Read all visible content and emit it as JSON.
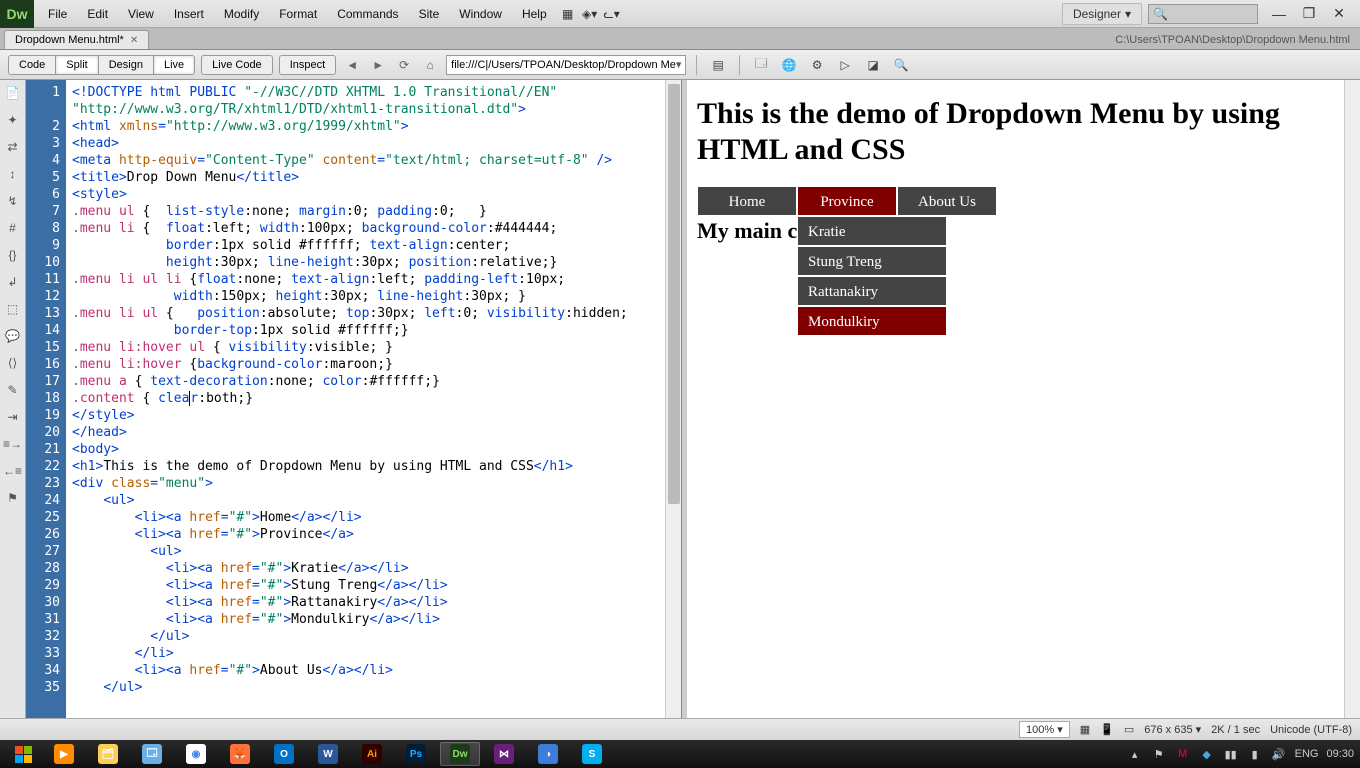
{
  "app": {
    "logo": "Dw"
  },
  "menu": {
    "items": [
      "File",
      "Edit",
      "View",
      "Insert",
      "Modify",
      "Format",
      "Commands",
      "Site",
      "Window",
      "Help"
    ]
  },
  "workspace": {
    "label": "Designer"
  },
  "search": {
    "placeholder": ""
  },
  "doc_tab": {
    "name": "Dropdown Menu.html*",
    "path": "C:\\Users\\TPOAN\\Desktop\\Dropdown Menu.html"
  },
  "view_modes": {
    "code": "Code",
    "split": "Split",
    "design": "Design",
    "live": "Live"
  },
  "sec_buttons": {
    "live_code": "Live Code",
    "inspect": "Inspect"
  },
  "address": "file:///C|/Users/TPOAN/Desktop/Dropdown Me",
  "code_lines": [
    {
      "n": 1,
      "html": "<span class='t-blue'>&lt;!DOCTYPE html PUBLIC </span><span class='t-green'>\"-//W3C//DTD XHTML 1.0 Transitional//EN\"</span>"
    },
    {
      "n": 0,
      "html": "<span class='t-green'>\"http://www.w3.org/TR/xhtml1/DTD/xhtml1-transitional.dtd\"</span><span class='t-blue'>&gt;</span>"
    },
    {
      "n": 2,
      "html": "<span class='t-blue'>&lt;html </span><span class='t-orange'>xmlns</span><span class='t-blue'>=</span><span class='t-green'>\"http://www.w3.org/1999/xhtml\"</span><span class='t-blue'>&gt;</span>"
    },
    {
      "n": 3,
      "html": "<span class='t-blue'>&lt;head&gt;</span>"
    },
    {
      "n": 4,
      "html": "<span class='t-blue'>&lt;meta </span><span class='t-orange'>http-equiv</span><span class='t-blue'>=</span><span class='t-green'>\"Content-Type\"</span> <span class='t-orange'>content</span><span class='t-blue'>=</span><span class='t-green'>\"text/html; charset=utf-8\"</span> <span class='t-blue'>/&gt;</span>"
    },
    {
      "n": 5,
      "html": "<span class='t-blue'>&lt;title&gt;</span>Drop Down Menu<span class='t-blue'>&lt;/title&gt;</span>"
    },
    {
      "n": 6,
      "html": "<span class='t-blue'>&lt;style&gt;</span>"
    },
    {
      "n": 7,
      "html": "<span class='t-pink'>.menu ul</span> {  <span class='t-blue'>list-style</span>:none; <span class='t-blue'>margin</span>:0; <span class='t-blue'>padding</span>:0;   }"
    },
    {
      "n": 8,
      "html": "<span class='t-pink'>.menu li</span> {  <span class='t-blue'>float</span>:left; <span class='t-blue'>width</span>:100px; <span class='t-blue'>background-color</span>:#444444;"
    },
    {
      "n": 9,
      "html": "            <span class='t-blue'>border</span>:1px solid #ffffff; <span class='t-blue'>text-align</span>:center;"
    },
    {
      "n": 10,
      "html": "            <span class='t-blue'>height</span>:30px; <span class='t-blue'>line-height</span>:30px; <span class='t-blue'>position</span>:relative;}"
    },
    {
      "n": 11,
      "html": "<span class='t-pink'>.menu li ul li</span> {<span class='t-blue'>float</span>:none; <span class='t-blue'>text-align</span>:left; <span class='t-blue'>padding-left</span>:10px;"
    },
    {
      "n": 12,
      "html": "             <span class='t-blue'>width</span>:150px; <span class='t-blue'>height</span>:30px; <span class='t-blue'>line-height</span>:30px; }"
    },
    {
      "n": 13,
      "html": "<span class='t-pink'>.menu li ul</span> {   <span class='t-blue'>position</span>:absolute; <span class='t-blue'>top</span>:30px; <span class='t-blue'>left</span>:0; <span class='t-blue'>visibility</span>:hidden;"
    },
    {
      "n": 14,
      "html": "             <span class='t-blue'>border-top</span>:1px solid #ffffff;}"
    },
    {
      "n": 15,
      "html": "<span class='t-pink'>.menu li:hover ul</span> { <span class='t-blue'>visibility</span>:visible; }"
    },
    {
      "n": 16,
      "html": "<span class='t-pink'>.menu li:hover</span> {<span class='t-blue'>background-color</span>:maroon;}"
    },
    {
      "n": 17,
      "html": "<span class='t-pink'>.menu a</span> { <span class='t-blue'>text-decoration</span>:none; <span class='t-blue'>color</span>:#ffffff;}"
    },
    {
      "n": 18,
      "html": "<span class='t-pink'>.content</span> { <span class='t-blue'>clea<span class='caret'></span>r</span>:both;}"
    },
    {
      "n": 19,
      "html": "<span class='t-blue'>&lt;/style&gt;</span>"
    },
    {
      "n": 20,
      "html": "<span class='t-blue'>&lt;/head&gt;</span>"
    },
    {
      "n": 21,
      "html": "<span class='t-blue'>&lt;body&gt;</span>"
    },
    {
      "n": 22,
      "html": "<span class='t-blue'>&lt;h1&gt;</span>This is the demo of Dropdown Menu by using HTML and CSS<span class='t-blue'>&lt;/h1&gt;</span>"
    },
    {
      "n": 23,
      "html": "<span class='t-blue'>&lt;div </span><span class='t-orange'>class</span><span class='t-blue'>=</span><span class='t-green'>\"menu\"</span><span class='t-blue'>&gt;</span>"
    },
    {
      "n": 24,
      "html": "    <span class='t-blue'>&lt;ul&gt;</span>"
    },
    {
      "n": 25,
      "html": "        <span class='t-blue'>&lt;li&gt;&lt;a </span><span class='t-orange'>href</span><span class='t-blue'>=</span><span class='t-green'>\"#\"</span><span class='t-blue'>&gt;</span>Home<span class='t-blue'>&lt;/a&gt;&lt;/li&gt;</span>"
    },
    {
      "n": 26,
      "html": "        <span class='t-blue'>&lt;li&gt;&lt;a </span><span class='t-orange'>href</span><span class='t-blue'>=</span><span class='t-green'>\"#\"</span><span class='t-blue'>&gt;</span>Province<span class='t-blue'>&lt;/a&gt;</span>"
    },
    {
      "n": 27,
      "html": "          <span class='t-blue'>&lt;ul&gt;</span>"
    },
    {
      "n": 28,
      "html": "            <span class='t-blue'>&lt;li&gt;&lt;a </span><span class='t-orange'>href</span><span class='t-blue'>=</span><span class='t-green'>\"#\"</span><span class='t-blue'>&gt;</span>Kratie<span class='t-blue'>&lt;/a&gt;&lt;/li&gt;</span>"
    },
    {
      "n": 29,
      "html": "            <span class='t-blue'>&lt;li&gt;&lt;a </span><span class='t-orange'>href</span><span class='t-blue'>=</span><span class='t-green'>\"#\"</span><span class='t-blue'>&gt;</span>Stung Treng<span class='t-blue'>&lt;/a&gt;&lt;/li&gt;</span>"
    },
    {
      "n": 30,
      "html": "            <span class='t-blue'>&lt;li&gt;&lt;a </span><span class='t-orange'>href</span><span class='t-blue'>=</span><span class='t-green'>\"#\"</span><span class='t-blue'>&gt;</span>Rattanakiry<span class='t-blue'>&lt;/a&gt;&lt;/li&gt;</span>"
    },
    {
      "n": 31,
      "html": "            <span class='t-blue'>&lt;li&gt;&lt;a </span><span class='t-orange'>href</span><span class='t-blue'>=</span><span class='t-green'>\"#\"</span><span class='t-blue'>&gt;</span>Mondulkiry<span class='t-blue'>&lt;/a&gt;&lt;/li&gt;</span>"
    },
    {
      "n": 32,
      "html": "          <span class='t-blue'>&lt;/ul&gt;</span>"
    },
    {
      "n": 33,
      "html": "        <span class='t-blue'>&lt;/li&gt;</span>"
    },
    {
      "n": 34,
      "html": "        <span class='t-blue'>&lt;li&gt;&lt;a </span><span class='t-orange'>href</span><span class='t-blue'>=</span><span class='t-green'>\"#\"</span><span class='t-blue'>&gt;</span>About Us<span class='t-blue'>&lt;/a&gt;&lt;/li&gt;</span>"
    },
    {
      "n": 35,
      "html": "    <span class='t-blue'>&lt;/ul&gt;</span>"
    }
  ],
  "preview": {
    "h1": "This is the demo of Dropdown Menu by using HTML and CSS",
    "menu": [
      "Home",
      "Province",
      "About Us"
    ],
    "active_idx": 1,
    "dropdown": [
      "Kratie",
      "Stung Treng",
      "Rattanakiry",
      "Mondulkiry"
    ],
    "hover_idx": 3,
    "content": "My main c"
  },
  "status": {
    "zoom": "100%",
    "dims": "676 x 635 ▾",
    "size": "2K / 1 sec",
    "encoding": "Unicode (UTF-8)"
  },
  "tray": {
    "lang": "ENG",
    "time": "09:30"
  }
}
